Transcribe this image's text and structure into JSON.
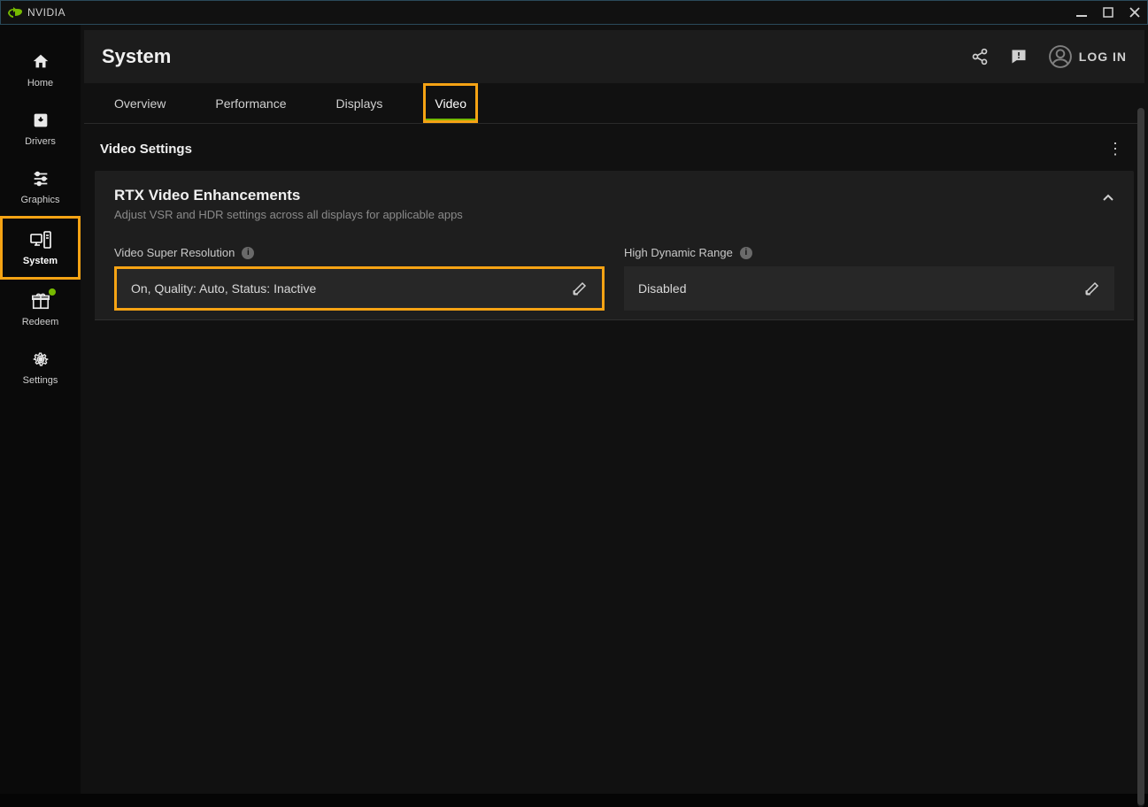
{
  "titlebar": {
    "brand": "NVIDIA"
  },
  "sidebar": {
    "items": [
      {
        "label": "Home"
      },
      {
        "label": "Drivers"
      },
      {
        "label": "Graphics"
      },
      {
        "label": "System"
      },
      {
        "label": "Redeem"
      },
      {
        "label": "Settings"
      }
    ]
  },
  "page": {
    "title": "System"
  },
  "header": {
    "login": "LOG IN"
  },
  "tabs": [
    {
      "label": "Overview"
    },
    {
      "label": "Performance"
    },
    {
      "label": "Displays"
    },
    {
      "label": "Video"
    }
  ],
  "section": {
    "title": "Video Settings"
  },
  "panel": {
    "title": "RTX Video Enhancements",
    "subtitle": "Adjust VSR and HDR settings across all displays for applicable apps",
    "settings": [
      {
        "label": "Video Super Resolution",
        "value": "On, Quality: Auto, Status: Inactive"
      },
      {
        "label": "High Dynamic Range",
        "value": "Disabled"
      }
    ]
  }
}
